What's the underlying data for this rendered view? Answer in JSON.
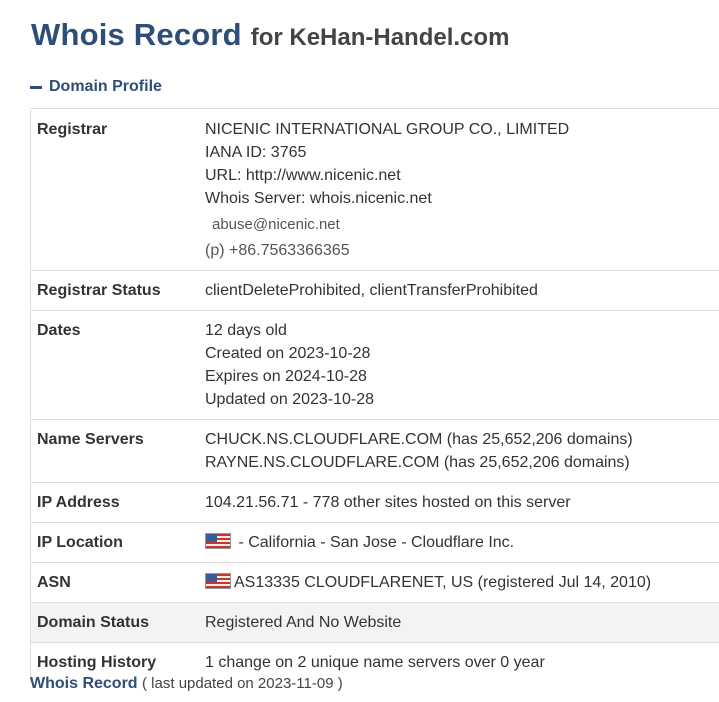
{
  "header": {
    "title": "Whois Record",
    "subtitle": "for KeHan-Handel.com"
  },
  "section": {
    "label": "Domain Profile"
  },
  "registrar": {
    "label": "Registrar",
    "name": "NICENIC INTERNATIONAL GROUP CO., LIMITED",
    "iana": "IANA ID: 3765",
    "url": "URL: http://www.nicenic.net",
    "whois_server": "Whois Server: whois.nicenic.net",
    "email": "abuse@nicenic.net",
    "phone_label": "(p)",
    "phone": "+86.7563366365"
  },
  "registrar_status": {
    "label": "Registrar Status",
    "value": "clientDeleteProhibited, clientTransferProhibited"
  },
  "dates": {
    "label": "Dates",
    "age": "12 days old",
    "created": "Created on 2023-10-28",
    "expires": "Expires on 2024-10-28",
    "updated": "Updated on 2023-10-28"
  },
  "name_servers": {
    "label": "Name Servers",
    "ns1": "CHUCK.NS.CLOUDFLARE.COM (has 25,652,206 domains)",
    "ns2": "RAYNE.NS.CLOUDFLARE.COM (has 25,652,206 domains)"
  },
  "ip_address": {
    "label": "IP Address",
    "value": "104.21.56.71 - 778 other sites hosted on this server"
  },
  "ip_location": {
    "label": "IP Location",
    "value": "- California - San Jose - Cloudflare Inc.",
    "flag_icon": "us-flag-icon"
  },
  "asn": {
    "label": "ASN",
    "value": "AS13335 CLOUDFLARENET, US (registered Jul 14, 2010)",
    "flag_icon": "us-flag-icon"
  },
  "domain_status": {
    "label": "Domain Status",
    "value": "Registered And No Website"
  },
  "hosting_history": {
    "label": "Hosting History",
    "value": "1 change on 2 unique name servers over 0 year"
  },
  "footer": {
    "link": "Whois Record",
    "updated": "( last updated on 2023-11-09 )"
  },
  "colors": {
    "accent": "#2e4e77",
    "text": "#333333",
    "border": "#dcdcdc",
    "shade": "#f3f3f3"
  }
}
